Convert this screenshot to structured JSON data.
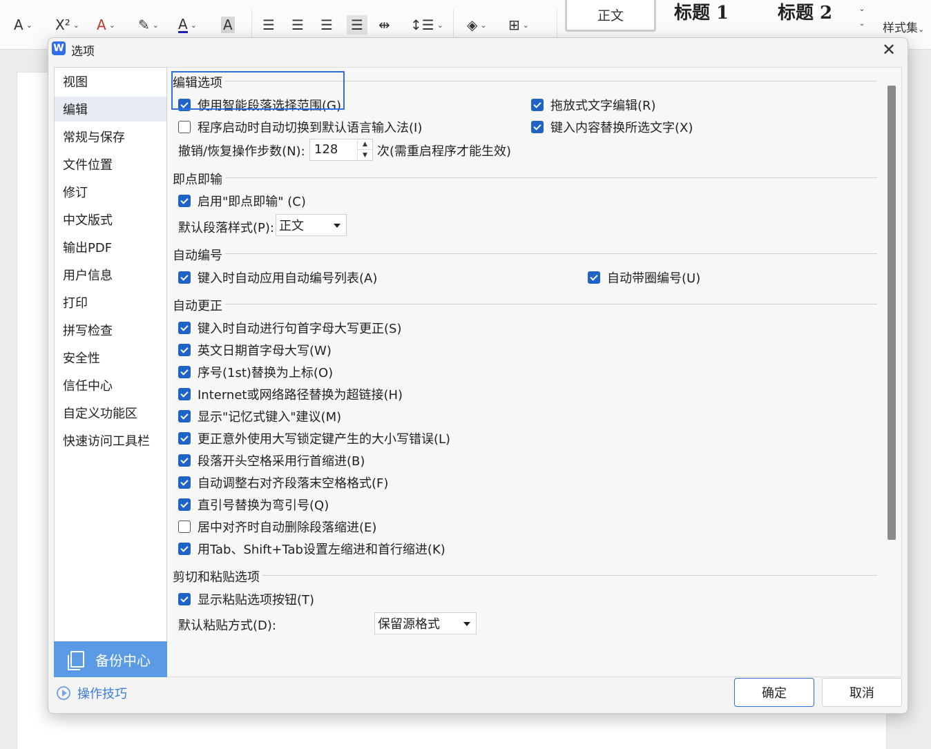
{
  "ribbon": {
    "icons": [
      "strikethrough-icon",
      "superscript-icon",
      "text-effect-icon",
      "highlight-icon",
      "font-color-icon",
      "char-shading-icon",
      "align-left-icon",
      "align-center-icon",
      "align-right-icon",
      "justify-icon",
      "distributed-icon",
      "line-spacing-icon",
      "shading-icon",
      "borders-icon"
    ],
    "superscript_label": "X²",
    "style_normal": "正文",
    "style_h1": "标题 1",
    "style_h2": "标题 2",
    "styleset_label": "样式集"
  },
  "dialog": {
    "title": "选项",
    "app_icon_letter": "W",
    "close_symbol": "✕"
  },
  "nav": {
    "items": [
      "视图",
      "编辑",
      "常规与保存",
      "文件位置",
      "修订",
      "中文版式",
      "输出PDF",
      "用户信息",
      "打印",
      "拼写检查",
      "安全性",
      "信任中心",
      "自定义功能区",
      "快速访问工具栏"
    ],
    "active_index": 1,
    "backup_label": "备份中心",
    "tips_label": "操作技巧"
  },
  "sections": {
    "edit": {
      "title": "编辑选项",
      "smart_para": "使用智能段落选择范围(G)",
      "auto_switch_ime": "程序启动时自动切换到默认语言输入法(I)",
      "drag_edit": "拖放式文字编辑(R)",
      "replace_selection": "键入内容替换所选文字(X)",
      "undo_label": "撤销/恢复操作步数(N):",
      "undo_value": "128",
      "undo_suffix": "次(需重启程序才能生效)"
    },
    "click_type": {
      "title": "即点即输",
      "enable": "启用\"即点即输\" (C)",
      "default_style_label": "默认段落样式(P):",
      "default_style_value": "正文"
    },
    "auto_number": {
      "title": "自动编号",
      "auto_list": "键入时自动应用自动编号列表(A)",
      "circled": "自动带圈编号(U)"
    },
    "auto_correct": {
      "title": "自动更正",
      "items": [
        "键入时自动进行句首字母大写更正(S)",
        "英文日期首字母大写(W)",
        "序号(1st)替换为上标(O)",
        "Internet或网络路径替换为超链接(H)",
        "显示\"记忆式键入\"建议(M)",
        "更正意外使用大写锁定键产生的大小写错误(L)",
        "段落开头空格采用行首缩进(B)",
        "自动调整右对齐段落末空格格式(F)",
        "直引号替换为弯引号(Q)",
        "居中对齐时自动删除段落缩进(E)",
        "用Tab、Shift+Tab设置左缩进和首行缩进(K)"
      ],
      "checked": [
        true,
        true,
        true,
        true,
        true,
        true,
        true,
        true,
        true,
        false,
        true
      ]
    },
    "paste": {
      "title": "剪切和粘贴选项",
      "show_button": "显示粘贴选项按钮(T)",
      "default_paste_label": "默认粘贴方式(D):",
      "default_paste_value": "保留源格式"
    }
  },
  "buttons": {
    "ok": "确定",
    "cancel": "取消"
  },
  "colors": {
    "accent": "#2f6ee8",
    "checkbox": "#1f63c6",
    "backup_bg": "#5b9be5"
  }
}
